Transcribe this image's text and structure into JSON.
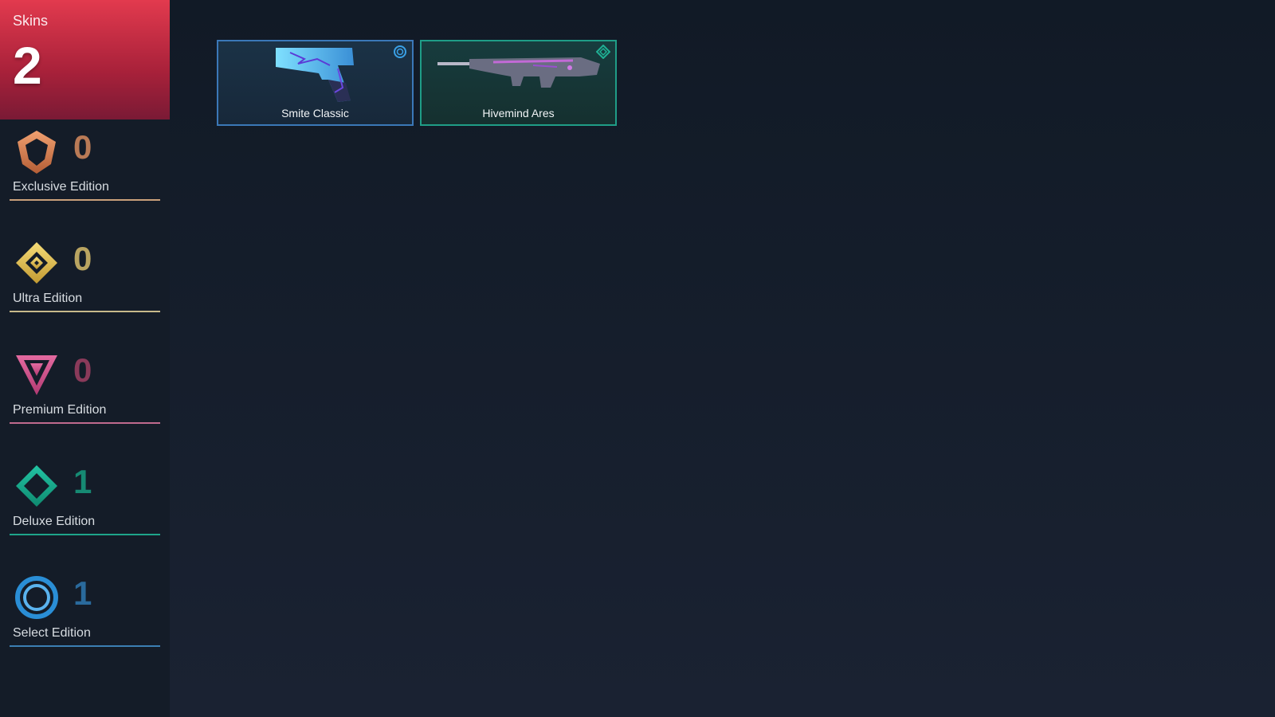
{
  "summary": {
    "label": "Skins",
    "count": "2"
  },
  "tiers": [
    {
      "name": "Exclusive Edition",
      "count": "0",
      "icon": "exclusive-edition-icon",
      "color": "#d98a5a"
    },
    {
      "name": "Ultra Edition",
      "count": "0",
      "icon": "ultra-edition-icon",
      "color": "#e6c65a"
    },
    {
      "name": "Premium Edition",
      "count": "0",
      "icon": "premium-edition-icon",
      "color": "#d45a8e"
    },
    {
      "name": "Deluxe Edition",
      "count": "1",
      "icon": "deluxe-edition-icon",
      "color": "#18a88d"
    },
    {
      "name": "Select Edition",
      "count": "1",
      "icon": "select-edition-icon",
      "color": "#2a8ed6"
    }
  ],
  "skins": [
    {
      "name": "Smite Classic",
      "tier_icon": "select-edition-icon",
      "image_icon": "pistol-icon"
    },
    {
      "name": "Hivemind Ares",
      "tier_icon": "deluxe-edition-icon",
      "image_icon": "rifle-icon"
    }
  ]
}
